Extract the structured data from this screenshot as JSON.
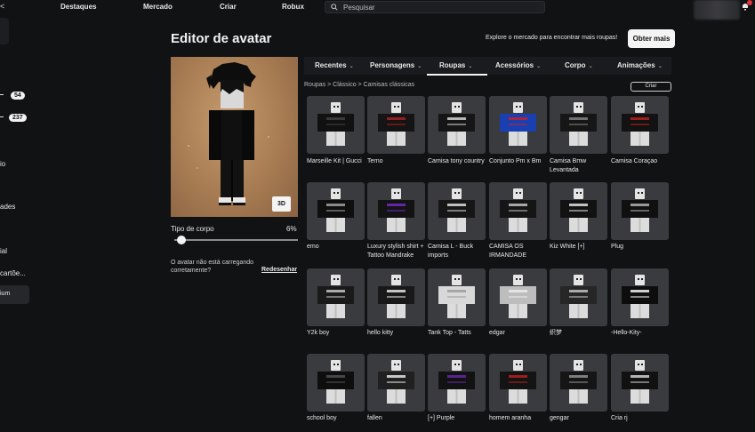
{
  "topbar": {
    "nav": [
      "Destaques",
      "Mercado",
      "Criar",
      "Robux"
    ],
    "search_placeholder": "Pesquisar"
  },
  "sidebar": {
    "mark": "<",
    "items": [
      {
        "label": "",
        "badge": "54"
      },
      {
        "label": "",
        "badge": "237"
      },
      {
        "label": "io",
        "badge": ""
      },
      {
        "label": "ades",
        "badge": ""
      },
      {
        "label": "ial",
        "badge": ""
      },
      {
        "label": "cartõe...",
        "badge": ""
      },
      {
        "label": "ium",
        "badge": ""
      }
    ]
  },
  "page": {
    "title": "Editor de avatar",
    "explore_text": "Explore o mercado para encontrar mais roupas!",
    "get_more": "Obter mais"
  },
  "preview": {
    "btn_3d": "3D",
    "body_type_label": "Tipo de corpo",
    "body_type_value": "6%",
    "body_type_fraction": 0.06,
    "warning": "O avatar não está carregando corretamente?",
    "redraw": "Redesenhar"
  },
  "tabs": [
    {
      "label": "Recentes"
    },
    {
      "label": "Personagens"
    },
    {
      "label": "Roupas"
    },
    {
      "label": "Acessórios"
    },
    {
      "label": "Corpo"
    },
    {
      "label": "Animações"
    }
  ],
  "breadcrumb": {
    "a": "Roupas",
    "b": "Clássico",
    "c": "Camisas clássicas",
    "sep": ">"
  },
  "create_button": "Criar",
  "items": [
    {
      "label": "Marseille Kit | Gucci",
      "color": "#111111",
      "accent": "#444444"
    },
    {
      "label": "Terno",
      "color": "#141414",
      "accent": "#b02020"
    },
    {
      "label": "Camisa tony country",
      "color": "#151515",
      "accent": "#dddddd"
    },
    {
      "label": "Conjunto Pm x Bm",
      "color": "#1a3fb0",
      "accent": "#d02020"
    },
    {
      "label": "Camisa Bmw Levantada",
      "color": "#161616",
      "accent": "#888888"
    },
    {
      "label": "Camisa Coraçao",
      "color": "#121212",
      "accent": "#c02020"
    },
    {
      "label": "emo",
      "color": "#0f0f0f",
      "accent": "#aaaaaa"
    },
    {
      "label": "Luxury stylish shirt + Tattoo Mandrake",
      "color": "#131313",
      "accent": "#7a2ad0"
    },
    {
      "label": "Camisa L - Buck imports",
      "color": "#161616",
      "accent": "#e8e8e8"
    },
    {
      "label": "CAMISA OS IRMANDADE",
      "color": "#151515",
      "accent": "#cccccc"
    },
    {
      "label": "Kiz White [+]",
      "color": "#121212",
      "accent": "#eeeeee"
    },
    {
      "label": "Plug",
      "color": "#101010",
      "accent": "#bbbbbb"
    },
    {
      "label": "Y2k boy",
      "color": "#1a1a1a",
      "accent": "#d0d0d0"
    },
    {
      "label": "hello kitty",
      "color": "#181818",
      "accent": "#f0f0f0"
    },
    {
      "label": "Tank Top - Tatts",
      "color": "#d8d8d8",
      "accent": "#999999"
    },
    {
      "label": "edgar",
      "color": "#bdbdbd",
      "accent": "#eeeeee"
    },
    {
      "label": "织梦",
      "color": "#262626",
      "accent": "#cccccc"
    },
    {
      "label": "-Hello-Kity-",
      "color": "#0d0d0d",
      "accent": "#ffffff"
    },
    {
      "label": "school boy",
      "color": "#0e0e0e",
      "accent": "#555555"
    },
    {
      "label": "fallen",
      "color": "#202020",
      "accent": "#f0f0f0"
    },
    {
      "label": "[+] Purple",
      "color": "#121212",
      "accent": "#6a2ab0"
    },
    {
      "label": "homem aranha",
      "color": "#141414",
      "accent": "#c02020"
    },
    {
      "label": "gengar",
      "color": "#151515",
      "accent": "#999999"
    },
    {
      "label": "Cria rj",
      "color": "#111111",
      "accent": "#dddddd"
    }
  ]
}
